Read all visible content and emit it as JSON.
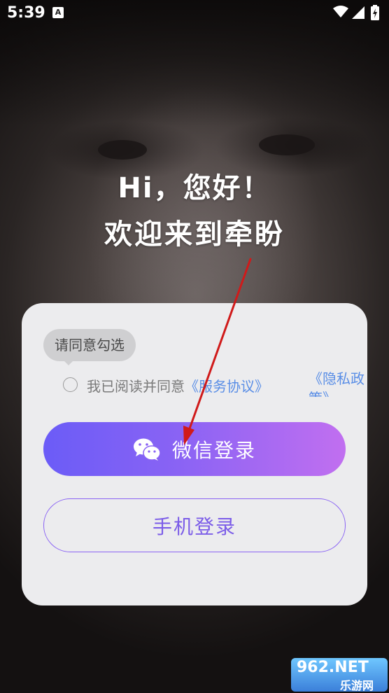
{
  "status_bar": {
    "time": "5:39",
    "notification_badge": "A",
    "icons": [
      "wifi-icon",
      "signal-icon",
      "battery-icon"
    ]
  },
  "greeting": {
    "line1": "Hi，您好！",
    "line2": "欢迎来到牵盼"
  },
  "login_card": {
    "tooltip": "请同意勾选",
    "agreement": {
      "prefix": "我已阅读并同意",
      "service_link": "《服务协议》",
      "privacy_link": "《隐私政策》",
      "checked": false
    },
    "wechat_button": {
      "label": "微信登录",
      "icon": "wechat-icon"
    },
    "phone_button": {
      "label": "手机登录"
    }
  },
  "watermark": {
    "brand": "962.NET",
    "sub": "乐游网"
  },
  "colors": {
    "accent_start": "#6b5cf7",
    "accent_end": "#c16ff0",
    "link": "#5a8ee6",
    "card_bg": "#ececee",
    "annotation_arrow": "#d01a1a"
  }
}
